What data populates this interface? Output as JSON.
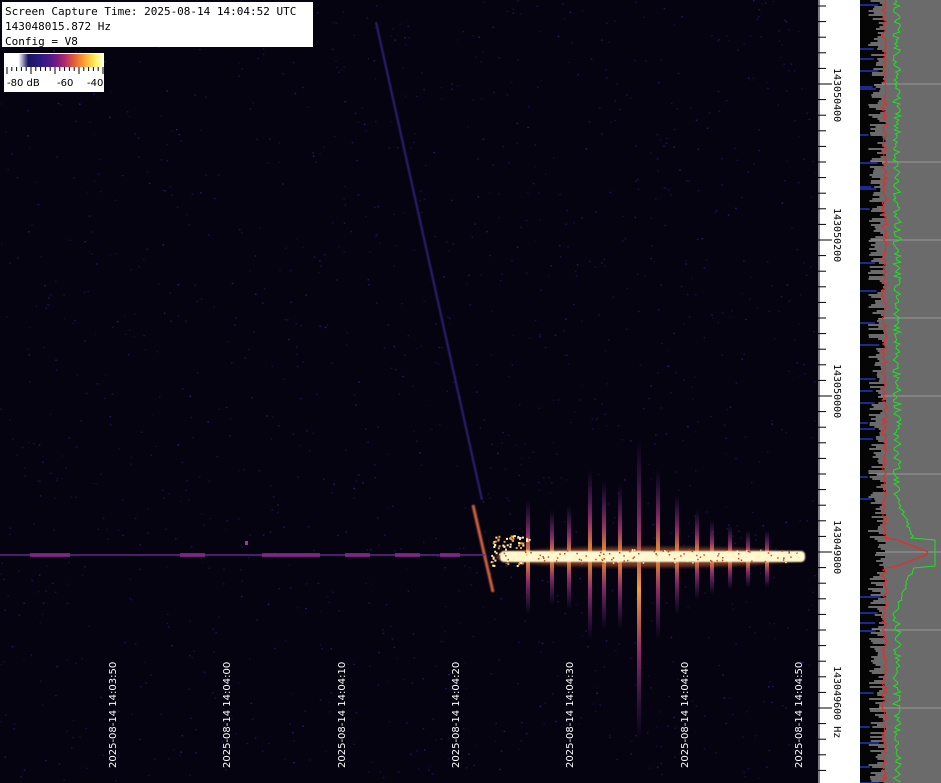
{
  "info": {
    "capture_time": "Screen Capture Time: 2025-08-14 14:04:52 UTC",
    "frequency": "143048015.872 Hz",
    "config": "Config = V8"
  },
  "colorbar": {
    "labels": [
      "-80 dB",
      "-60",
      "-40"
    ]
  },
  "time_axis": {
    "labels": [
      "2025-08-14 14:03:50",
      "2025-08-14 14:04:00",
      "2025-08-14 14:04:10",
      "2025-08-14 14:04:20",
      "2025-08-14 14:04:30",
      "2025-08-14 14:04:40",
      "2025-08-14 14:04:50"
    ]
  },
  "freq_axis": {
    "labels": [
      "143050400",
      "143050200",
      "143050000",
      "143049800",
      "143049600 Hz"
    ]
  },
  "colors": {
    "background": "#05030f",
    "trace_red": "#ff2020",
    "trace_green": "#20e020",
    "spectrum_bg": "#6b6b6b",
    "signal_hot": "#fff8d0",
    "signal_orange": "#f0a030",
    "signal_purple": "#7a2a9a"
  }
}
